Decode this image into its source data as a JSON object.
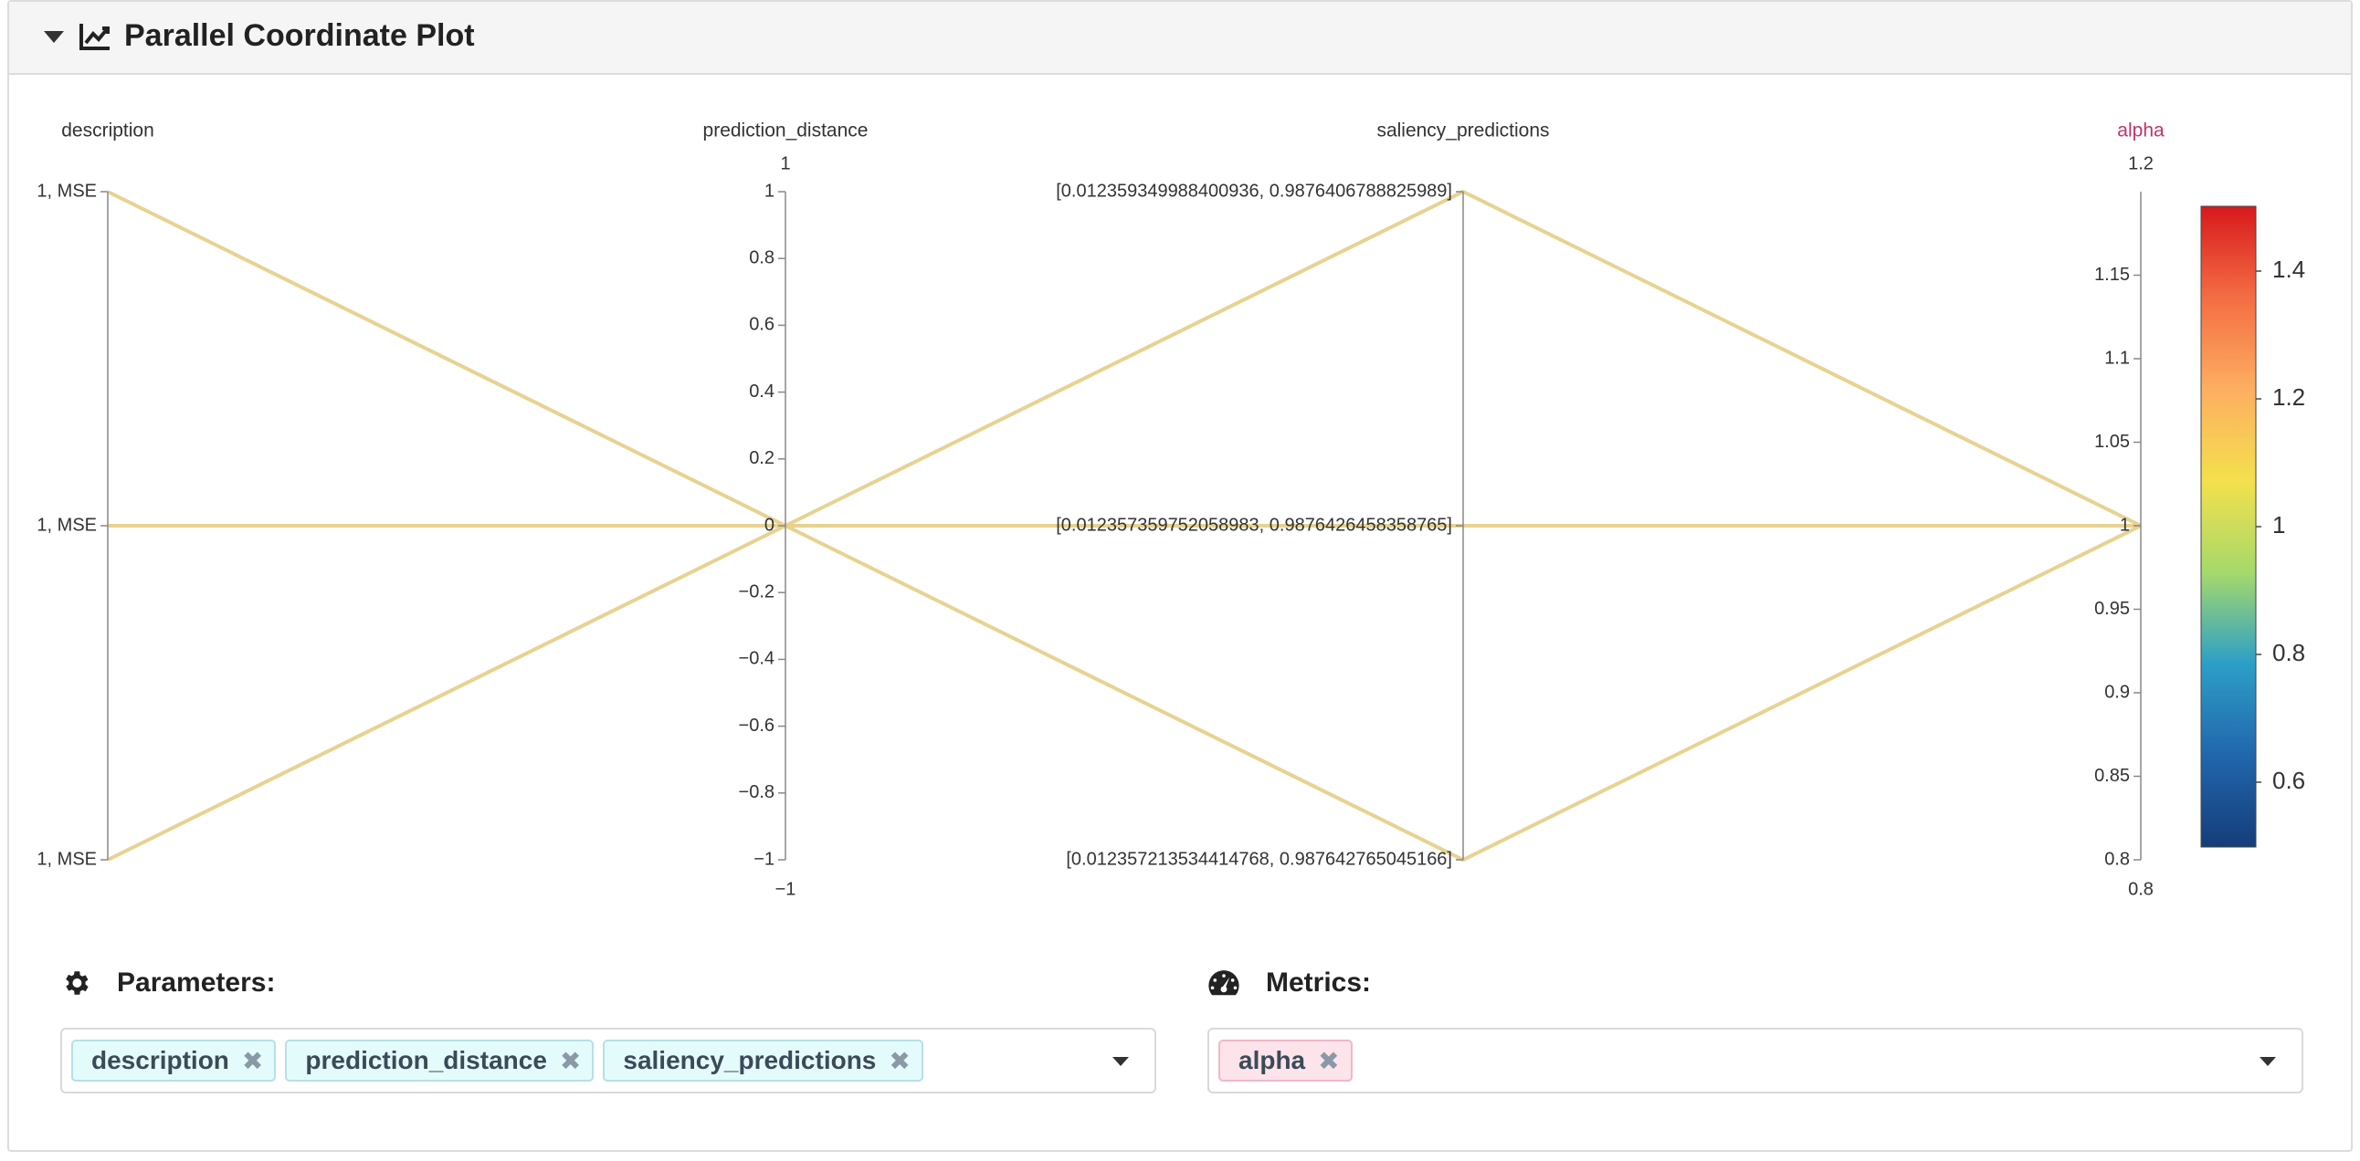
{
  "header": {
    "title": "Parallel Coordinate Plot"
  },
  "chart_data": {
    "type": "parallel-coordinates",
    "axes": [
      {
        "name": "description",
        "kind": "categorical",
        "ticks": [
          "1, MSE",
          "1, MSE",
          "1, MSE"
        ]
      },
      {
        "name": "prediction_distance",
        "kind": "numeric",
        "range": [
          -1,
          1
        ],
        "top_label": "1",
        "bottom_label": "−1",
        "ticks": [
          "1",
          "0.8",
          "0.6",
          "0.4",
          "0.2",
          "0",
          "−0.2",
          "−0.4",
          "−0.6",
          "−0.8",
          "−1"
        ]
      },
      {
        "name": "saliency_predictions",
        "kind": "categorical",
        "ticks": [
          "[0.012359349988400936, 0.9876406788825989]",
          "[0.012357359752058983, 0.9876426458358765]",
          "[0.012357213534414768, 0.987642765045166]"
        ]
      },
      {
        "name": "alpha",
        "kind": "numeric",
        "range": [
          0.8,
          1.2
        ],
        "top_label": "1.2",
        "bottom_label": "0.8",
        "ticks": [
          "1.15",
          "1.1",
          "1.05",
          "1",
          "0.95",
          "0.9",
          "0.85",
          "0.8"
        ]
      }
    ],
    "lines": [
      {
        "description": 0,
        "prediction_distance": 0,
        "saliency_predictions": 0,
        "alpha": 1
      },
      {
        "description": 1,
        "prediction_distance": 0,
        "saliency_predictions": 1,
        "alpha": 1
      },
      {
        "description": 2,
        "prediction_distance": 0,
        "saliency_predictions": 2,
        "alpha": 1
      }
    ],
    "line_color": "#e6d08a",
    "colorbar": {
      "ticks": [
        "1.4",
        "1.2",
        "1",
        "0.8",
        "0.6"
      ],
      "colors": [
        "#d7191c",
        "#f46d43",
        "#fdae61",
        "#f4e04d",
        "#a6d96a",
        "#2c9fc7",
        "#2166ac",
        "#153d7a"
      ]
    },
    "metric_axis_color": "#c0336b"
  },
  "parameters": {
    "label": "Parameters:",
    "chips": [
      "description",
      "prediction_distance",
      "saliency_predictions"
    ],
    "remove_glyph": "✖"
  },
  "metrics": {
    "label": "Metrics:",
    "chips": [
      "alpha"
    ],
    "remove_glyph": "✖"
  },
  "icons": {
    "collapse": "caret-down-icon",
    "chart": "line-chart-icon",
    "params": "gear-icon",
    "metrics": "dashboard-icon"
  }
}
